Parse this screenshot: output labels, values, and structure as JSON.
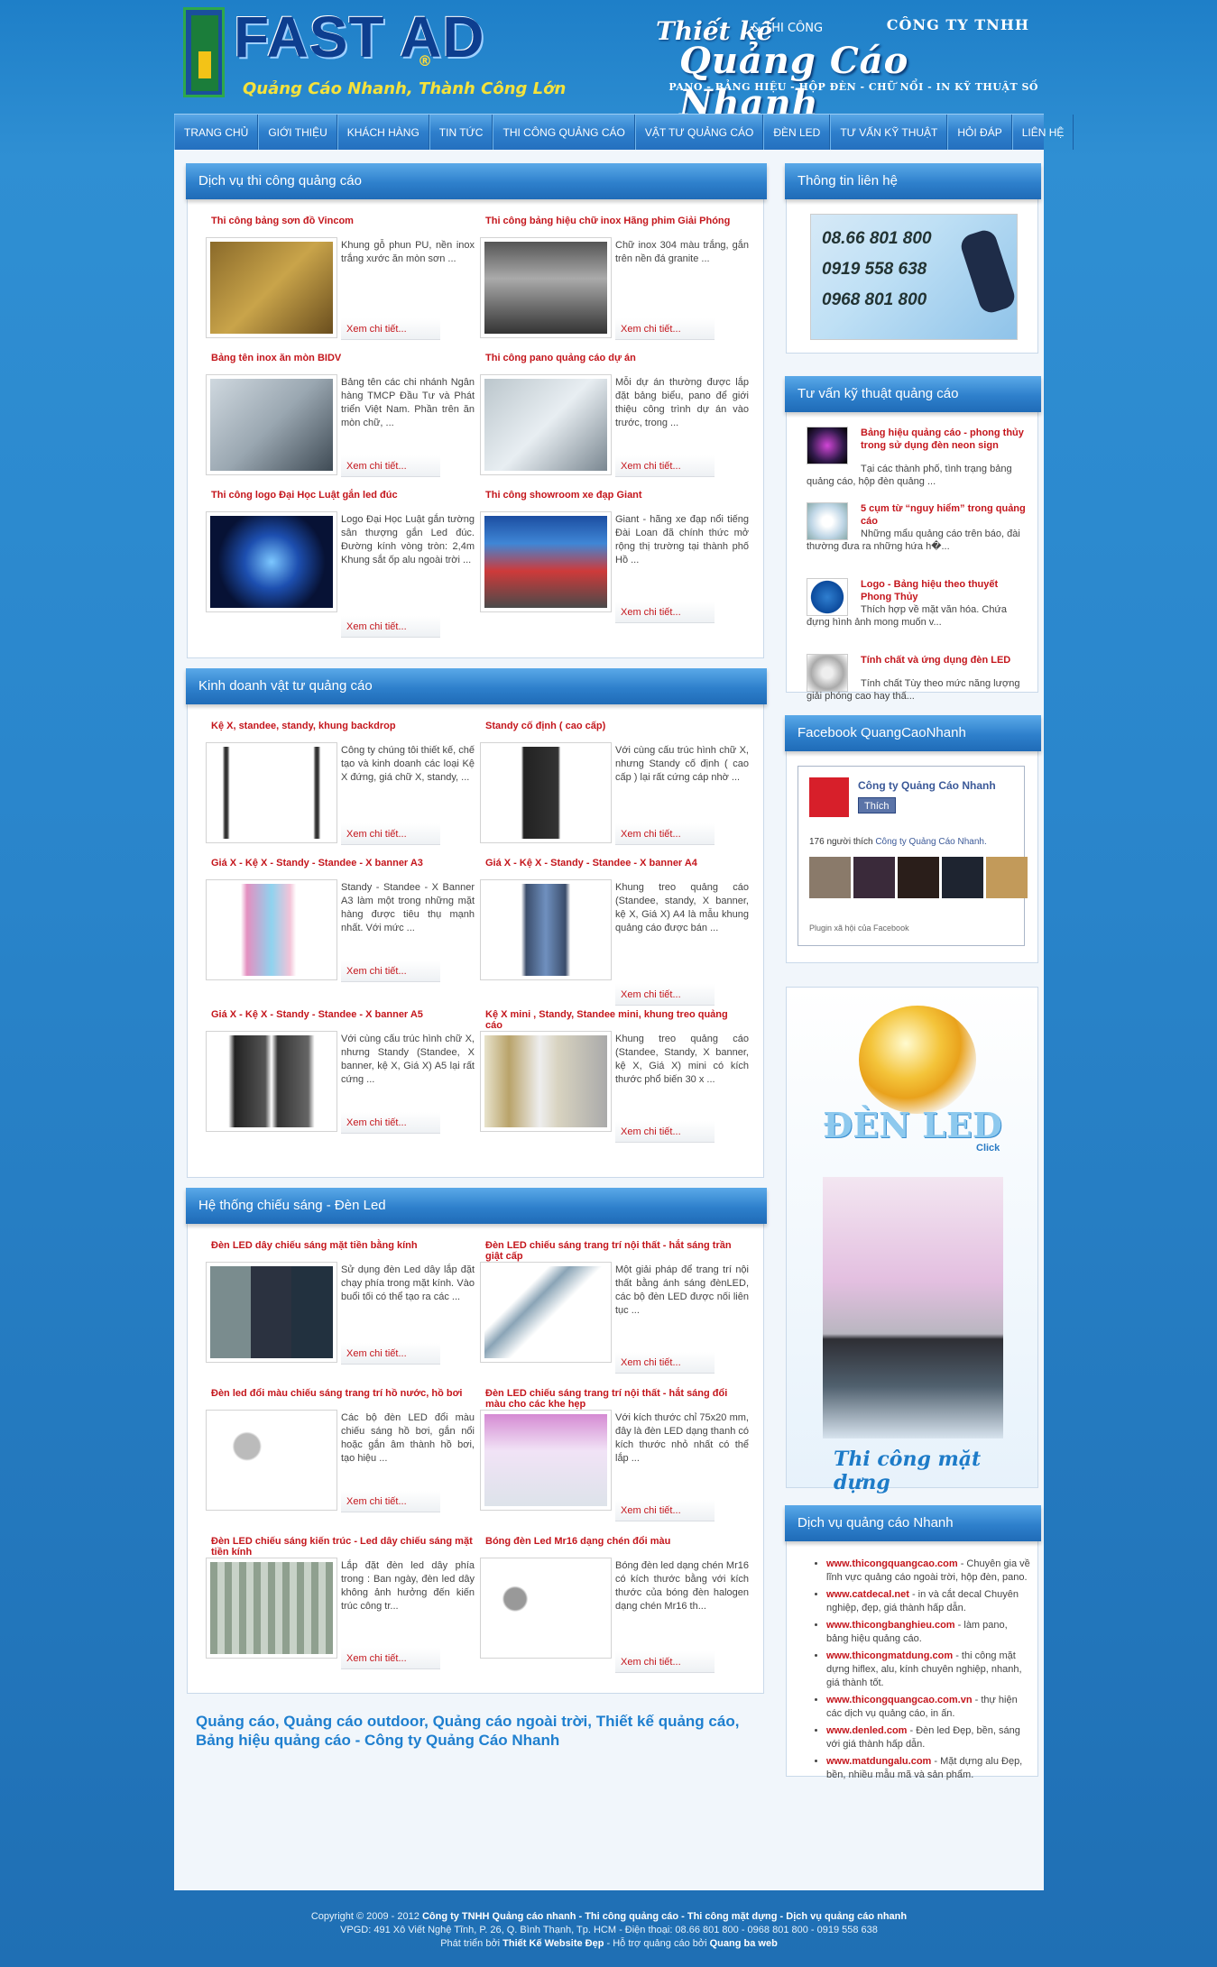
{
  "header": {
    "logo_text": "FAST AD",
    "logo_reg": "®",
    "logo_tagline": "Quảng Cáo Nhanh, Thành Công Lớn",
    "brand_script1": "Thiết kế",
    "brand_amp": "& THI CÔNG",
    "brand_company": "CÔNG TY TNHH",
    "brand_script2": "Quảng Cáo Nhanh",
    "brand_sub": "PANO - BẢNG HIỆU - HỘP ĐÈN - CHỮ NỔI - IN KỸ THUẬT SỐ"
  },
  "nav": [
    "TRANG CHỦ",
    "GIỚI THIỆU",
    "KHÁCH HÀNG",
    "TIN TỨC",
    "THI CÔNG QUẢNG CÁO",
    "VẬT TƯ QUẢNG CÁO",
    "ĐÈN LED",
    "TƯ VẤN KỸ THUẬT",
    "HỎI ĐÁP",
    "LIÊN HỆ"
  ],
  "section1": {
    "title": "Dịch vụ thi công quảng cáo",
    "items": [
      {
        "title": "Thi công bảng sơn đồ Vincom",
        "desc": "Khung gỗ phun PU, nền inox trắng xước ăn mòn sơn ...",
        "more": "Xem chi tiết..."
      },
      {
        "title": "Thi công bảng hiệu chữ inox Hãng phim Giải Phóng",
        "desc": "Chữ inox 304 màu trắng, gắn trên nền đá granite ...",
        "more": "Xem chi tiết..."
      },
      {
        "title": "Bảng tên inox ăn mòn BIDV",
        "desc": "Bảng tên các chi nhánh Ngân hàng TMCP Đầu Tư và Phát triển Việt Nam. Phần trên ăn mòn chữ, ...",
        "more": "Xem chi tiết..."
      },
      {
        "title": "Thi công pano quảng cáo dự án",
        "desc": "Mỗi dự án thường được lắp đặt bảng biểu, pano để giới thiệu công trình dự án vào trước, trong ...",
        "more": "Xem chi tiết..."
      },
      {
        "title": "Thi công logo Đại Học Luật gắn led đúc",
        "desc": "Logo Đại Học Luật gắn tường sân thượng gắn Led đúc. Đường kính vòng tròn: 2,4m Khung sắt ốp alu ngoài trời ...",
        "more": "Xem chi tiết..."
      },
      {
        "title": "Thi công showroom xe đạp Giant",
        "desc": "Giant - hãng xe đạp nổi tiếng Đài Loan đã chính thức mở rộng thị trường tại thành phố Hồ ...",
        "more": "Xem chi tiết..."
      }
    ]
  },
  "section2": {
    "title": "Kinh doanh vật tư quảng cáo",
    "items": [
      {
        "title": "Kệ X, standee, standy, khung backdrop",
        "desc": "Công ty chúng tôi thiết kế, chế tạo và kinh doanh các loại Kệ X đứng, giá chữ X, standy, ...",
        "more": "Xem chi tiết..."
      },
      {
        "title": "Standy cố định ( cao cấp)",
        "desc": "Với cùng cấu trúc hình chữ X, nhưng Standy cố định ( cao cấp ) lại rất cứng cáp nhờ ...",
        "more": "Xem chi tiết..."
      },
      {
        "title": "Giá X - Kệ X - Standy - Standee - X banner A3",
        "desc": "Standy - Standee - X Banner A3 làm một trong những mặt hàng được tiêu thụ mạnh nhất. Với mức ...",
        "more": "Xem chi tiết..."
      },
      {
        "title": "Giá X - Kệ X - Standy - Standee - X banner A4",
        "desc": "Khung treo quảng cáo (Standee, standy, X banner, kệ X, Giá X) A4 là mẫu khung quảng cáo được bán ...",
        "more": "Xem chi tiết..."
      },
      {
        "title": "Giá X - Kệ X - Standy - Standee - X banner A5",
        "desc": "Với cùng cấu trúc hình chữ X, nhưng Standy (Standee, X banner, kệ X, Giá X) A5 lại rất cứng ...",
        "more": "Xem chi tiết..."
      },
      {
        "title": "Kệ X mini , Standy, Standee mini, khung treo quảng cáo",
        "desc": "Khung treo quảng cáo (Standee, Standy, X banner, kệ X, Giá X) mini có kích thước phổ biến 30 x ...",
        "more": "Xem chi tiết..."
      }
    ]
  },
  "section3": {
    "title": "Hệ thống chiếu sáng - Đèn Led",
    "items": [
      {
        "title": "Đèn LED dây chiếu sáng mặt tiền bằng kính",
        "desc": "Sử dụng đèn Led dây lắp đặt chạy phía trong mặt kính. Vào buổi tối có thể tạo ra các ...",
        "more": "Xem chi tiết..."
      },
      {
        "title": "Đèn LED chiếu sáng trang trí nội thất - hắt sáng trần giật cấp",
        "desc": "Một giải pháp để trang trí nội thất bằng ánh sáng đènLED, các bộ đèn LED được nối liên tục ...",
        "more": "Xem chi tiết..."
      },
      {
        "title": "Đèn led đổi màu chiếu sáng trang trí hồ nước, hồ bơi",
        "desc": "Các bộ đèn LED đổi màu chiếu sáng hồ bơi, gắn nổi hoặc gắn âm thành hồ bơi, tạo hiệu ...",
        "more": "Xem chi tiết..."
      },
      {
        "title": "Đèn LED chiếu sáng trang trí nội thất - hắt sáng đổi màu cho các khe hẹp",
        "desc": "Với kích thước chỉ 75x20 mm, đây là đèn LED dạng thanh có kích thước nhỏ nhất có thể lắp ...",
        "more": "Xem chi tiết..."
      },
      {
        "title": "Đèn LED chiếu sáng kiến trúc - Led dây chiếu sáng mặt tiền kính",
        "desc": "Lắp đặt đèn led dây phía trong : Ban ngày, đèn led dây không ảnh hưởng đến kiến trúc công tr...",
        "more": "Xem chi tiết..."
      },
      {
        "title": "Bóng đèn Led Mr16 dạng chén đổi màu",
        "desc": "Bóng đèn led dạng chén Mr16 có kích thước bằng với kích thước của bóng đèn halogen dạng chén Mr16 th...",
        "more": "Xem chi tiết..."
      }
    ]
  },
  "footer_keywords": "Quảng cáo, Quảng cáo outdoor, Quảng cáo ngoài trời, Thiết kế quảng cáo, Bảng hiệu quảng cáo - Công ty Quảng Cáo Nhanh",
  "sidebar": {
    "contact_title": "Thông tin liên hệ",
    "phones": [
      "08.66 801 800",
      "0919 558 638",
      "0968 801 800"
    ],
    "tips_title": "Tư vấn kỹ thuật quảng cáo",
    "tips": [
      {
        "title": "Bảng hiệu quảng cáo - phong thủy trong sử dụng đèn neon sign",
        "desc": "Tại các thành phố, tình trạng bảng quảng cáo, hộp đèn quảng ..."
      },
      {
        "title": "5 cụm từ “nguy hiểm” trong quảng cáo",
        "desc": "Những mẩu quảng cáo trên báo, đài thường đưa ra những hứa h�..."
      },
      {
        "title": "Logo - Bảng hiệu theo thuyết Phong Thủy",
        "desc": "Thích hợp về mặt văn hóa. Chứa đựng hình ảnh mong muốn v..."
      },
      {
        "title": "Tính chất và ứng dụng đèn LED",
        "desc": "Tính chất Tùy theo mức năng lượng giải phóng cao hay thấ..."
      }
    ],
    "facebook_title": "Facebook QuangCaoNhanh",
    "fb_page_name": "Công ty Quảng Cáo Nhanh",
    "fb_like": "Thích",
    "fb_count_pre": "176 người thích",
    "fb_count_link": "Công ty Quảng Cáo Nhanh.",
    "fb_plugin": "Plugin xã hội của Facebook",
    "banner_led": "ĐÈN LED",
    "banner_click": "Click",
    "banner_facade": "Thi công mặt dựng",
    "links_title": "Dịch vụ quảng cáo Nhanh",
    "links": [
      {
        "site": "www.thicongquangcao.com",
        "desc": " - Chuyên gia về lĩnh vực quảng cáo ngoài trời, hộp đèn, pano."
      },
      {
        "site": "www.catdecal.net",
        "desc": " - in và cắt decal Chuyên nghiệp, đẹp, giá thành hấp dẫn."
      },
      {
        "site": "www.thicongbanghieu.com",
        "desc": " - làm pano, bảng hiệu quảng cáo."
      },
      {
        "site": "www.thicongmatdung.com",
        "desc": " - thi công mặt dựng hiflex, alu, kính chuyên nghiệp, nhanh, giá thành tốt."
      },
      {
        "site": "www.thicongquangcao.com.vn",
        "desc": " - thự hiện các dịch vụ quảng cáo, in ấn."
      },
      {
        "site": "www.denled.com",
        "desc": " - Đèn led Đẹp, bền, sáng với giá thành hấp dẫn."
      },
      {
        "site": "www.matdungalu.com",
        "desc": " - Mặt dựng alu Đẹp, bền, nhiều mẫu mã và sản phẩm."
      }
    ]
  },
  "footer": {
    "line1_pre": "Copyright © 2009 - 2012",
    "line1_bold": "Công ty TNHH Quảng cáo nhanh - Thi công quảng cáo - Thi công mặt dựng - Dịch vụ quảng cáo nhanh",
    "line2": "VPGD: 491 Xô Viết Nghệ Tĩnh, P. 26, Q. Bình Thạnh, Tp. HCM - Điện thoại: 08.66 801 800 - 0968 801 800 - 0919 558 638",
    "line3_pre": "Phát triển bởi",
    "line3_b1": "Thiết Kế Website Đẹp",
    "line3_mid": "- Hỗ trợ quảng cáo bởi",
    "line3_b2": "Quang ba web"
  }
}
